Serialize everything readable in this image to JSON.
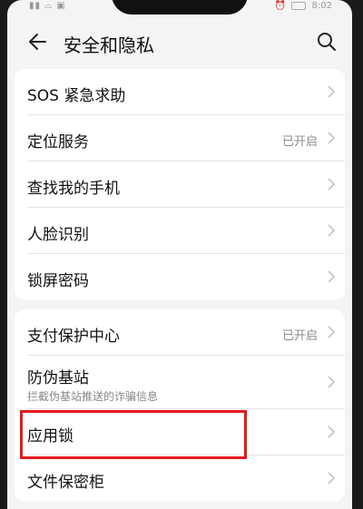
{
  "status_bar": {
    "left": "▮▮ ⌓ ▣",
    "time": "8:02"
  },
  "header": {
    "title": "安全和隐私"
  },
  "groups": [
    {
      "items": [
        {
          "label": "SOS 紧急求助",
          "status": ""
        },
        {
          "label": "定位服务",
          "status": "已开启"
        },
        {
          "label": "查找我的手机",
          "status": ""
        },
        {
          "label": "人脸识别",
          "status": ""
        },
        {
          "label": "锁屏密码",
          "status": ""
        }
      ]
    },
    {
      "items": [
        {
          "label": "支付保护中心",
          "status": "已开启"
        },
        {
          "label": "防伪基站",
          "subtitle": "拦截伪基站推送的诈骗信息"
        },
        {
          "label": "应用锁",
          "status": ""
        },
        {
          "label": "文件保密柜",
          "status": ""
        }
      ]
    }
  ],
  "highlight_color": "#e21b1b",
  "icons": [
    "back-arrow-icon",
    "search-icon",
    "chevron-right-icon"
  ]
}
